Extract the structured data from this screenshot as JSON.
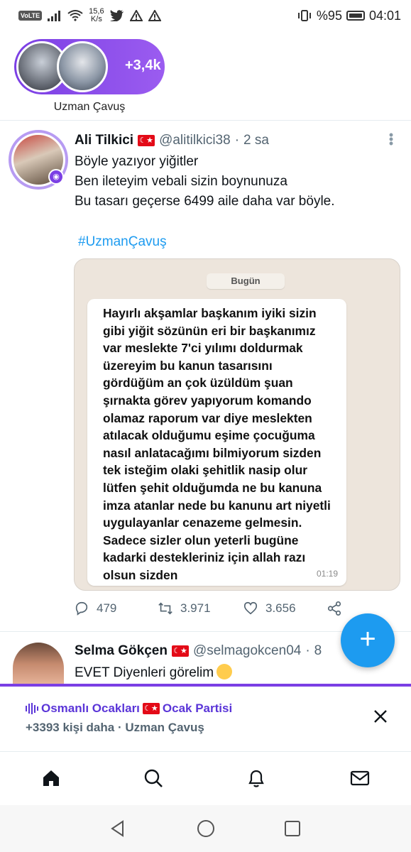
{
  "status_bar": {
    "volte": "VoLTE",
    "speed_value": "15,6",
    "speed_unit": "K/s",
    "battery": "%95",
    "time": "04:01"
  },
  "space": {
    "count": "+3,4k",
    "title": "Uzman Çavuş"
  },
  "tweet": {
    "name": "Ali Tilkici",
    "flag": "🇹🇷",
    "handle": "@alitilkici38",
    "dot": "·",
    "time": "2 sa",
    "lines": [
      "Böyle yazıyor yiğitler",
      "Ben ileteyim vebali sizin boynunuza",
      "Bu tasarı geçerse 6499 aile daha var böyle."
    ],
    "hashtag": "#UzmanÇavuş",
    "media": {
      "date_chip": "Bugün",
      "message_lines": [
        "Hayırlı akşamlar başkanım iyiki sizin",
        "gibi yiğit sözünün eri bir başkanımız",
        "var meslekte 7'ci yılımı doldurmak",
        "üzereyim bu kanun tasarısını",
        "gördüğüm an çok üzüldüm şuan",
        "şırnakta görev yapıyorum  komando",
        "olamaz raporum var diye meslekten",
        "atılacak olduğumu eşime çocuğuma",
        "nasıl anlatacağımı bilmiyorum sizden",
        "tek isteğim olaki şehitlik nasip olur",
        "lütfen şehit olduğumda ne bu kanuna",
        "imza atanlar nede bu kanunu art niyetli",
        "uygulayanlar cenazeme gelmesin.",
        "Sadece sizler olun yeterli bugüne",
        "kadarki destekleriniz için allah razı",
        "olsun sizden"
      ],
      "message_time": "01:19"
    },
    "actions": {
      "replies": "479",
      "retweets": "3.971",
      "likes": "3.656"
    }
  },
  "tweet2": {
    "name": "Selma Gökçen",
    "flag": "🇹🇷",
    "handle": "@selmagokcen04",
    "dot": "·",
    "time_partial": "8",
    "text": "EVET Diyenleri görelim"
  },
  "space_dock": {
    "title_part1": "Osmanlı Ocakları",
    "flag": "🇹🇷",
    "title_part2": "Ocak Partisi",
    "subtitle": "+3393 kişi daha · Uzman Çavuş"
  },
  "fab": {
    "label": "+"
  },
  "colors": {
    "accent_blue": "#1d9bf0",
    "spaces_purple": "#7b3fe4",
    "text_primary": "#0f1419",
    "text_secondary": "#536471"
  }
}
